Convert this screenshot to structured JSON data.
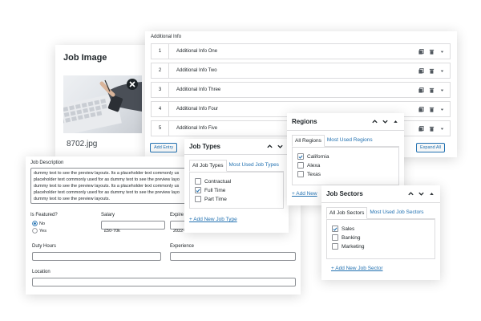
{
  "job_image": {
    "title": "Job Image",
    "filename": "8702.jpg"
  },
  "additional_info": {
    "title": "Additional Info",
    "rows": [
      {
        "num": "1",
        "label": "Additional Info One"
      },
      {
        "num": "2",
        "label": "Additional Info Two"
      },
      {
        "num": "3",
        "label": "Additional Info Three"
      },
      {
        "num": "4",
        "label": "Additional Info Four"
      },
      {
        "num": "5",
        "label": "Additional Info Five"
      }
    ],
    "add_button": "Add Entry",
    "expand_button": "Expand All"
  },
  "job_details": {
    "description_label": "Job Description",
    "description_lines": [
      "dummy text to see the preview layouts. Its a placeholder text commonly us",
      "placeholder text commonly used for as dummy text to see the preview layo",
      "dummy text to see the preview layouts. Its a placeholder text commonly us",
      "placeholder text commonly used for as dummy text to see the preview layo",
      "dummy text to see the preview layouts."
    ],
    "featured_label": "Is Featured?",
    "featured_options": [
      "No",
      "Yes"
    ],
    "salary_label": "Salary",
    "salary_value": "£50-70k",
    "expire_label": "Expire",
    "expire_value": "2022-",
    "duty_hours_label": "Duty Hours",
    "experience_label": "Experience",
    "location_label": "Location"
  },
  "job_types": {
    "title": "Job Types",
    "tabs": [
      "All Job Types",
      "Most Used Job Types"
    ],
    "items": [
      {
        "label": "Contractual",
        "checked": false
      },
      {
        "label": "Full Time",
        "checked": true
      },
      {
        "label": "Part Time",
        "checked": false
      }
    ],
    "add_link": "+ Add New Job Type"
  },
  "regions": {
    "title": "Regions",
    "tabs": [
      "All Regions",
      "Most Used Regions"
    ],
    "items": [
      {
        "label": "California",
        "checked": true
      },
      {
        "label": "Alexa",
        "checked": false
      },
      {
        "label": "Texas",
        "checked": false
      }
    ],
    "add_link": "+ Add New"
  },
  "job_sectors": {
    "title": "Job Sectors",
    "tabs": [
      "All Job Sectors",
      "Most Used Job Sectors"
    ],
    "items": [
      {
        "label": "Sales",
        "checked": true
      },
      {
        "label": "Banking",
        "checked": false
      },
      {
        "label": "Marketing",
        "checked": false
      }
    ],
    "add_link": "+ Add New Job Sector"
  },
  "colors": {
    "link": "#2271b1",
    "border": "#dcdcde",
    "text": "#1d2327"
  }
}
